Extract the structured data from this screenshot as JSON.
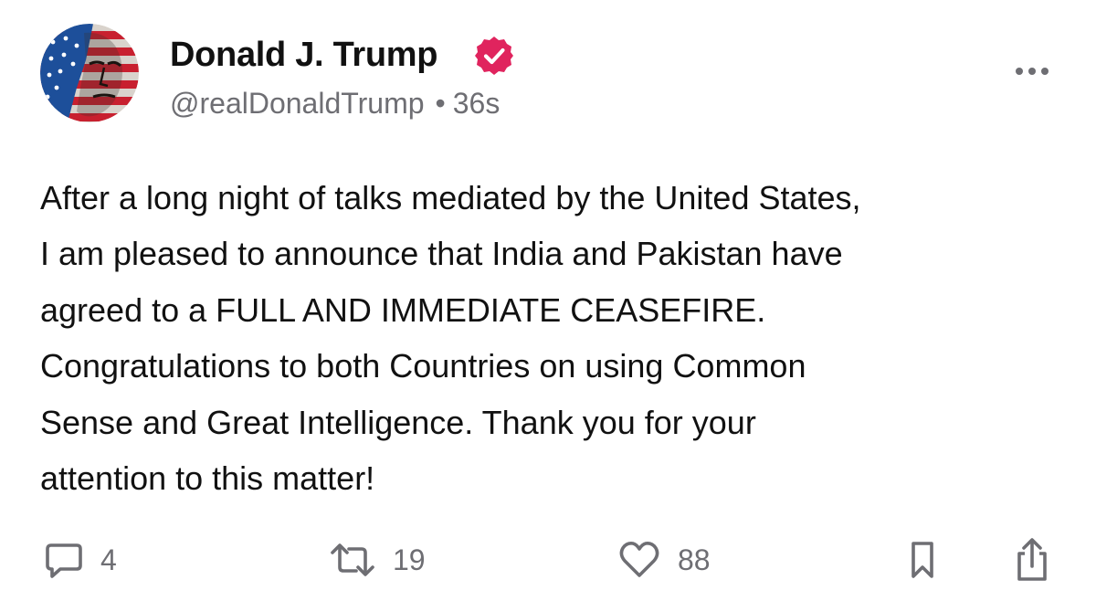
{
  "post": {
    "author": {
      "display_name": "Donald J. Trump",
      "handle": "@realDonaldTrump",
      "verified": true,
      "verified_color": "#e0245e"
    },
    "timestamp": "36s",
    "separator": "•",
    "body_lines": [
      "After a long night of talks mediated by the United States,",
      "I am pleased to announce that India and Pakistan have",
      "agreed to a FULL AND IMMEDIATE CEASEFIRE.",
      "Congratulations to both Countries on using Common",
      "Sense and Great Intelligence. Thank you for your",
      "attention to this matter!"
    ],
    "actions": {
      "replies": "4",
      "reposts": "19",
      "likes": "88"
    },
    "icons": {
      "more": "more-horizontal-icon",
      "reply": "comment-bubble-icon",
      "repost": "repost-arrows-icon",
      "like": "heart-icon",
      "bookmark": "bookmark-icon",
      "share": "share-upload-icon"
    }
  }
}
